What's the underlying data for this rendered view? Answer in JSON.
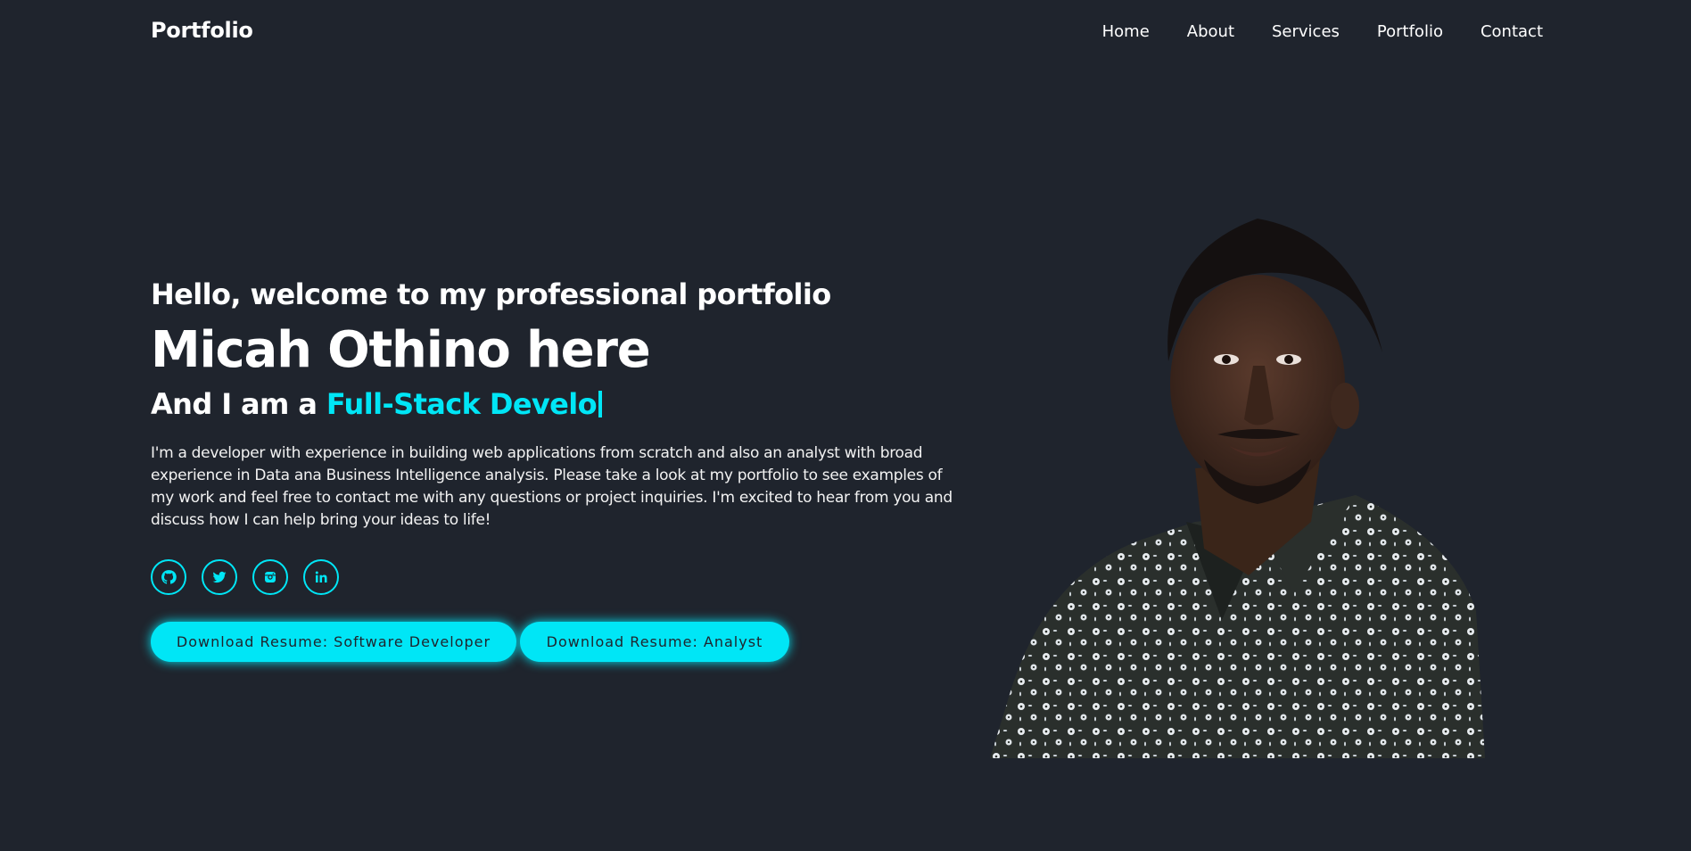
{
  "header": {
    "logo": "Portfolio",
    "nav": [
      "Home",
      "About",
      "Services",
      "Portfolio",
      "Contact"
    ]
  },
  "hero": {
    "greeting": "Hello, welcome to my professional portfolio",
    "name": "Micah Othino here",
    "role_prefix": "And I am a ",
    "role_typed": "Full-Stack Develo",
    "bio": "I'm a developer with experience in building web applications from scratch and also an analyst with broad experience in Data ana Business Intelligence analysis. Please take a look at my portfolio to see examples of my work and feel free to contact me with any questions or project inquiries. I'm excited to hear from you and discuss how I can help bring your ideas to life!",
    "socials": [
      "github-icon",
      "twitter-icon",
      "instagram-icon",
      "linkedin-icon"
    ],
    "buttons": {
      "resume_dev": "Download Resume: Software Developer",
      "resume_analyst": "Download Resume: Analyst"
    }
  },
  "colors": {
    "background": "#1f242d",
    "accent": "#00e6f6",
    "text": "#ffffff"
  }
}
